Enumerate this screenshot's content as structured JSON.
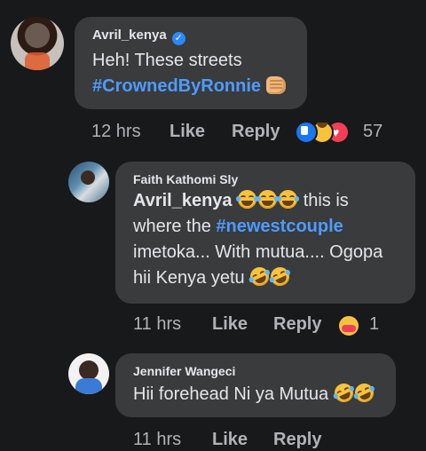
{
  "comments": [
    {
      "author": "Avril_kenya",
      "verified": true,
      "text_line1": "Heh! These streets",
      "hashtag": "#CrownedByRonnie",
      "time": "12 hrs",
      "like": "Like",
      "reply": "Reply",
      "reaction_count": "57",
      "reactions": [
        "like-icon",
        "laughing-face-icon",
        "love-icon"
      ],
      "emoji_after": [
        "raised-fist-icon"
      ]
    },
    {
      "author": "Faith Kathomi Sly",
      "mention": "Avril_kenya",
      "text_a": "this is",
      "text_b": "where the",
      "hashtag": "#newestcouple",
      "text_c": "imetoka... With mutua.... Ogopa",
      "text_d": "hii Kenya yetu",
      "time": "11 hrs",
      "like": "Like",
      "reply": "Reply",
      "reaction_count": "1",
      "reactions": [
        "care-face-icon"
      ]
    },
    {
      "author": "Jennifer Wangeci",
      "text": "Hii forehead Ni ya Mutua",
      "time": "11 hrs",
      "like": "Like",
      "reply": "Reply"
    }
  ],
  "colors": {
    "background": "#18191a",
    "bubble": "#3a3b3c",
    "hashtag": "#4e9bff",
    "secondary_text": "#b0b3b8"
  }
}
